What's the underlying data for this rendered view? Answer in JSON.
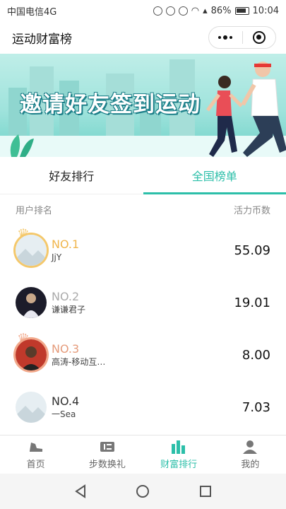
{
  "status_bar": {
    "carrier": "中国电信4G",
    "battery": "86%",
    "time": "10:04"
  },
  "app": {
    "title": "运动财富榜"
  },
  "banner": {
    "text": "邀请好友签到运动"
  },
  "tabs": [
    {
      "label": "好友排行",
      "active": false
    },
    {
      "label": "全国榜单",
      "active": true
    }
  ],
  "list_header": {
    "left": "用户排名",
    "right": "活力币数"
  },
  "rankings": [
    {
      "rank": "NO.1",
      "name": "JjY",
      "score": "55.09"
    },
    {
      "rank": "NO.2",
      "name": "谦谦君子",
      "score": "19.01"
    },
    {
      "rank": "NO.3",
      "name": "高涛-移动互…",
      "score": "8.00"
    },
    {
      "rank": "NO.4",
      "name": "一Sea",
      "score": "7.03"
    }
  ],
  "tabbar": [
    {
      "label": "首页",
      "icon": "sneaker-icon"
    },
    {
      "label": "步数换礼",
      "icon": "ticket-icon"
    },
    {
      "label": "财富排行",
      "icon": "bar-chart-icon",
      "active": true
    },
    {
      "label": "我的",
      "icon": "person-icon"
    }
  ],
  "colors": {
    "accent": "#2cbfa9",
    "gold": "#f0b64d",
    "silver": "#aaaaaa",
    "bronze": "#e59b7b"
  }
}
